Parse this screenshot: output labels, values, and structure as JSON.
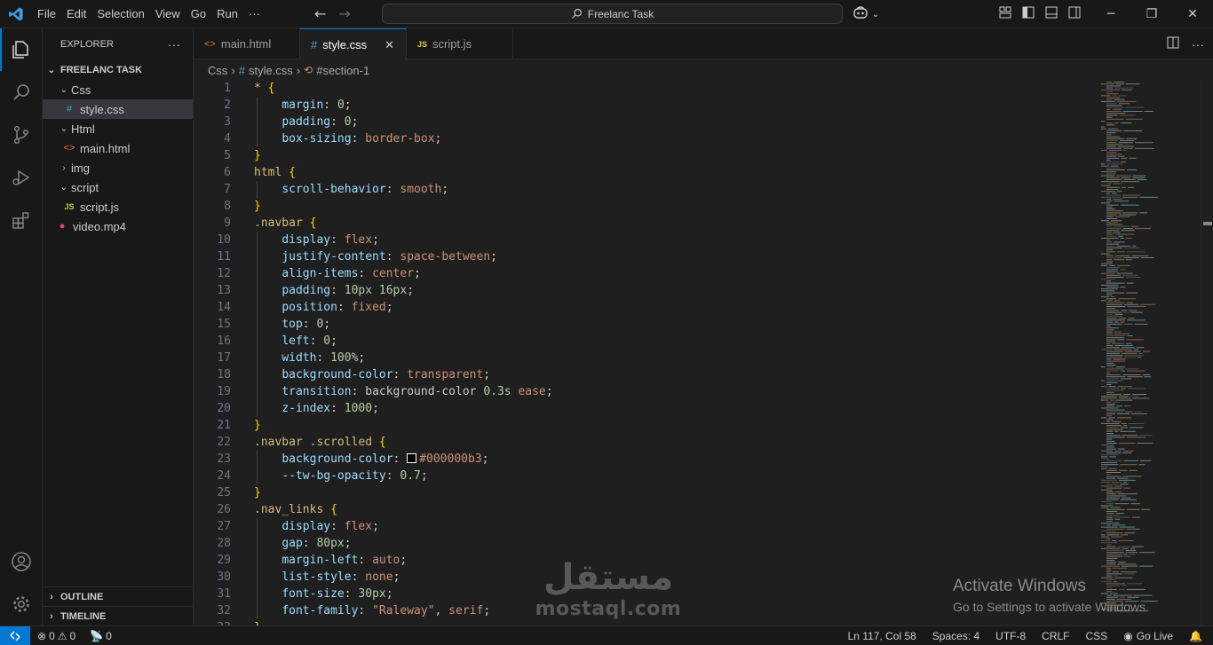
{
  "titlebar": {
    "menu": [
      "File",
      "Edit",
      "Selection",
      "View",
      "Go",
      "Run",
      "···"
    ],
    "search_text": "Freelanc Task"
  },
  "sidebar": {
    "title": "EXPLORER",
    "more": "···",
    "root": "FREELANC TASK",
    "tree": [
      {
        "label": "Css",
        "type": "folder-open",
        "depth": 1
      },
      {
        "label": "style.css",
        "type": "css",
        "depth": 2,
        "selected": true
      },
      {
        "label": "Html",
        "type": "folder-open",
        "depth": 1
      },
      {
        "label": "main.html",
        "type": "html",
        "depth": 2
      },
      {
        "label": "img",
        "type": "folder-closed",
        "depth": 1
      },
      {
        "label": "script",
        "type": "folder-open",
        "depth": 1
      },
      {
        "label": "script.js",
        "type": "js",
        "depth": 2
      },
      {
        "label": "video.mp4",
        "type": "video",
        "depth": 1
      }
    ],
    "outline": "OUTLINE",
    "timeline": "TIMELINE"
  },
  "tabs": [
    {
      "label": "main.html",
      "icon": "html",
      "active": false
    },
    {
      "label": "style.css",
      "icon": "css",
      "active": true
    },
    {
      "label": "script.js",
      "icon": "js",
      "active": false
    }
  ],
  "breadcrumb": {
    "folder": "Css",
    "file": "style.css",
    "symbol": "#section-1"
  },
  "editor": {
    "lines": [
      [
        [
          "sel",
          "* "
        ],
        [
          "brace",
          "{"
        ]
      ],
      [
        [
          "ind",
          ""
        ],
        [
          "prop",
          "margin"
        ],
        [
          "punc",
          ": "
        ],
        [
          "num",
          "0"
        ],
        [
          "punc",
          ";"
        ]
      ],
      [
        [
          "ind",
          ""
        ],
        [
          "prop",
          "padding"
        ],
        [
          "punc",
          ": "
        ],
        [
          "num",
          "0"
        ],
        [
          "punc",
          ";"
        ]
      ],
      [
        [
          "ind",
          ""
        ],
        [
          "prop",
          "box-sizing"
        ],
        [
          "punc",
          ": "
        ],
        [
          "val",
          "border-box"
        ],
        [
          "punc",
          ";"
        ]
      ],
      [
        [
          "brace",
          "}"
        ]
      ],
      [
        [
          "sel",
          "html "
        ],
        [
          "brace",
          "{"
        ]
      ],
      [
        [
          "ind",
          ""
        ],
        [
          "prop",
          "scroll-behavior"
        ],
        [
          "punc",
          ": "
        ],
        [
          "val",
          "smooth"
        ],
        [
          "punc",
          ";"
        ]
      ],
      [
        [
          "brace",
          "}"
        ]
      ],
      [
        [
          "sel",
          ".navbar "
        ],
        [
          "brace",
          "{"
        ]
      ],
      [
        [
          "ind",
          ""
        ],
        [
          "prop",
          "display"
        ],
        [
          "punc",
          ": "
        ],
        [
          "val",
          "flex"
        ],
        [
          "punc",
          ";"
        ]
      ],
      [
        [
          "ind",
          ""
        ],
        [
          "prop",
          "justify-content"
        ],
        [
          "punc",
          ": "
        ],
        [
          "val",
          "space-between"
        ],
        [
          "punc",
          ";"
        ]
      ],
      [
        [
          "ind",
          ""
        ],
        [
          "prop",
          "align-items"
        ],
        [
          "punc",
          ": "
        ],
        [
          "val",
          "center"
        ],
        [
          "punc",
          ";"
        ]
      ],
      [
        [
          "ind",
          ""
        ],
        [
          "prop",
          "padding"
        ],
        [
          "punc",
          ": "
        ],
        [
          "num",
          "10px 16px"
        ],
        [
          "punc",
          ";"
        ]
      ],
      [
        [
          "ind",
          ""
        ],
        [
          "prop",
          "position"
        ],
        [
          "punc",
          ": "
        ],
        [
          "val",
          "fixed"
        ],
        [
          "punc",
          ";"
        ]
      ],
      [
        [
          "ind",
          ""
        ],
        [
          "prop",
          "top"
        ],
        [
          "punc",
          ": "
        ],
        [
          "num",
          "0"
        ],
        [
          "punc",
          ";"
        ]
      ],
      [
        [
          "ind",
          ""
        ],
        [
          "prop",
          "left"
        ],
        [
          "punc",
          ": "
        ],
        [
          "num",
          "0"
        ],
        [
          "punc",
          ";"
        ]
      ],
      [
        [
          "ind",
          ""
        ],
        [
          "prop",
          "width"
        ],
        [
          "punc",
          ": "
        ],
        [
          "num",
          "100%"
        ],
        [
          "punc",
          ";"
        ]
      ],
      [
        [
          "ind",
          ""
        ],
        [
          "prop",
          "background-color"
        ],
        [
          "punc",
          ": "
        ],
        [
          "val",
          "transparent"
        ],
        [
          "punc",
          ";"
        ]
      ],
      [
        [
          "ind",
          ""
        ],
        [
          "prop",
          "transition"
        ],
        [
          "punc",
          ": "
        ],
        [
          "punc",
          "background-color "
        ],
        [
          "num",
          "0.3s"
        ],
        [
          "punc",
          " "
        ],
        [
          "val",
          "ease"
        ],
        [
          "punc",
          ";"
        ]
      ],
      [
        [
          "ind",
          ""
        ],
        [
          "prop",
          "z-index"
        ],
        [
          "punc",
          ": "
        ],
        [
          "num",
          "1000"
        ],
        [
          "punc",
          ";"
        ]
      ],
      [
        [
          "brace",
          "}"
        ]
      ],
      [
        [
          "sel",
          ".navbar .scrolled "
        ],
        [
          "brace",
          "{"
        ]
      ],
      [
        [
          "ind",
          ""
        ],
        [
          "prop",
          "background-color"
        ],
        [
          "punc",
          ": "
        ],
        [
          "swatch",
          ""
        ],
        [
          "val",
          "#000000b3"
        ],
        [
          "punc",
          ";"
        ]
      ],
      [
        [
          "ind",
          ""
        ],
        [
          "prop",
          "--tw-bg-opacity"
        ],
        [
          "punc",
          ": "
        ],
        [
          "num",
          "0.7"
        ],
        [
          "punc",
          ";"
        ]
      ],
      [
        [
          "brace",
          "}"
        ]
      ],
      [
        [
          "sel",
          ".nav_links "
        ],
        [
          "brace",
          "{"
        ]
      ],
      [
        [
          "ind",
          ""
        ],
        [
          "prop",
          "display"
        ],
        [
          "punc",
          ": "
        ],
        [
          "val",
          "flex"
        ],
        [
          "punc",
          ";"
        ]
      ],
      [
        [
          "ind",
          ""
        ],
        [
          "prop",
          "gap"
        ],
        [
          "punc",
          ": "
        ],
        [
          "num",
          "80px"
        ],
        [
          "punc",
          ";"
        ]
      ],
      [
        [
          "ind",
          ""
        ],
        [
          "prop",
          "margin-left"
        ],
        [
          "punc",
          ": "
        ],
        [
          "val",
          "auto"
        ],
        [
          "punc",
          ";"
        ]
      ],
      [
        [
          "ind",
          ""
        ],
        [
          "prop",
          "list-style"
        ],
        [
          "punc",
          ": "
        ],
        [
          "val",
          "none"
        ],
        [
          "punc",
          ";"
        ]
      ],
      [
        [
          "ind",
          ""
        ],
        [
          "prop",
          "font-size"
        ],
        [
          "punc",
          ": "
        ],
        [
          "num",
          "30px"
        ],
        [
          "punc",
          ";"
        ]
      ],
      [
        [
          "ind",
          ""
        ],
        [
          "prop",
          "font-family"
        ],
        [
          "punc",
          ": "
        ],
        [
          "val",
          "\"Raleway\""
        ],
        [
          "punc",
          ", "
        ],
        [
          "val",
          "serif"
        ],
        [
          "punc",
          ";"
        ]
      ],
      [
        [
          "brace",
          "}"
        ]
      ]
    ]
  },
  "watermark": {
    "activate_title": "Activate Windows",
    "activate_sub": "Go to Settings to activate Windows.",
    "mostaql_ar": "مستقل",
    "mostaql_en": "mostaql.com"
  },
  "statusbar": {
    "errors": "0",
    "warnings": "0",
    "ports": "0",
    "position": "Ln 117, Col 58",
    "spaces": "Spaces: 4",
    "encoding": "UTF-8",
    "eol": "CRLF",
    "language": "CSS",
    "golive": "Go Live"
  },
  "colors": {
    "accent": "#0078d4",
    "selector": "#d7ba7d",
    "property": "#9cdcfe",
    "value": "#ce9178",
    "number": "#b5cea8",
    "brace": "#ffd700"
  }
}
